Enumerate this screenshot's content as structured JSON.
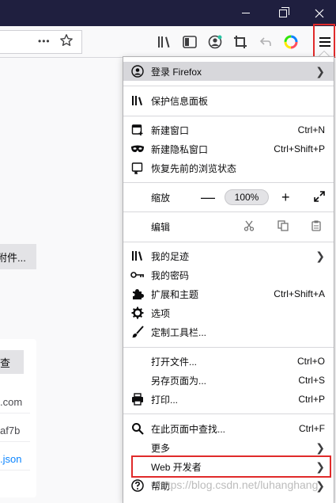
{
  "window": {
    "controls": {
      "minimize_icon": "minimize-icon",
      "restore_icon": "restore-icon",
      "close_icon": "close-icon"
    }
  },
  "toolbar": {
    "overflow": "•••",
    "icons": [
      "bookmark-star-icon",
      "library-icon",
      "sidebar-icon",
      "account-icon",
      "screenshot-icon",
      "back-arrow-icon",
      "color-wheel-icon",
      "hamburger-menu-icon"
    ]
  },
  "page": {
    "button_label": "附件...",
    "card_button_label": "查",
    "card_lines": [
      ".com",
      "af7b",
      ".json"
    ]
  },
  "menu": {
    "account": "登录 Firefox",
    "protections": "保护信息面板",
    "new_window": {
      "label": "新建窗口",
      "accel": "Ctrl+N"
    },
    "new_private": {
      "label": "新建隐私窗口",
      "accel": "Ctrl+Shift+P"
    },
    "restore_session": "恢复先前的浏览状态",
    "zoom": {
      "label": "缩放",
      "minus": "—",
      "value": "100%",
      "plus": "+"
    },
    "edit": {
      "label": "编辑"
    },
    "library": "我的足迹",
    "logins": "我的密码",
    "addons": {
      "label": "扩展和主题",
      "accel": "Ctrl+Shift+A"
    },
    "options": "选项",
    "customize": "定制工具栏...",
    "open_file": {
      "label": "打开文件...",
      "accel": "Ctrl+O"
    },
    "save_page": {
      "label": "另存页面为...",
      "accel": "Ctrl+S"
    },
    "print": {
      "label": "打印...",
      "accel": "Ctrl+P"
    },
    "find": {
      "label": "在此页面中查找...",
      "accel": "Ctrl+F"
    },
    "more": "更多",
    "web_developer": "Web 开发者",
    "help": "帮助"
  },
  "watermark": "https://blog.csdn.net/luhanghang",
  "colors": {
    "titlebar": "#1f1f3f",
    "highlight_border": "#e02a2a",
    "account_bg": "#d7d7db"
  }
}
